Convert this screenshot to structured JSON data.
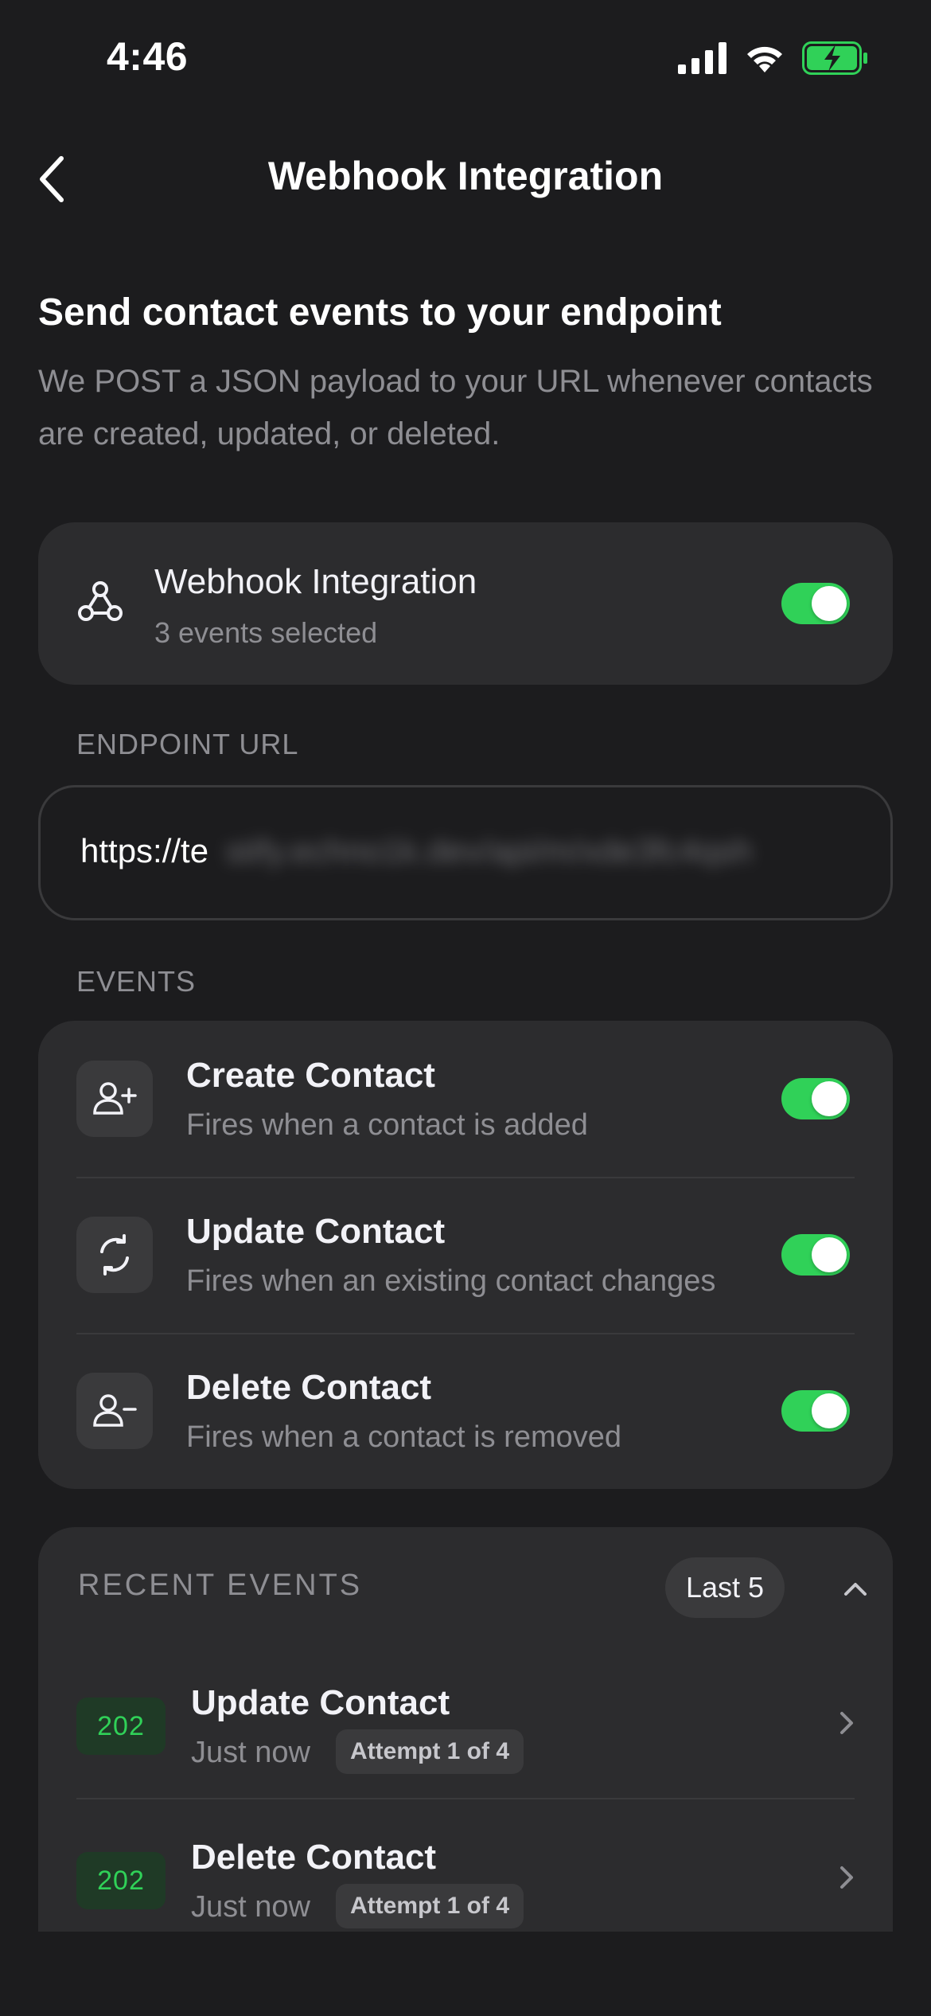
{
  "status_bar": {
    "time": "4:46"
  },
  "nav": {
    "title": "Webhook Integration"
  },
  "intro": {
    "heading": "Send contact events to your endpoint",
    "description": "We POST a JSON payload to your URL whenever contacts are created, updated, or deleted."
  },
  "integration": {
    "title": "Webhook Integration",
    "subtitle": "3 events selected",
    "enabled": true
  },
  "endpoint": {
    "label": "ENDPOINT URL",
    "url_visible": "https://te",
    "url_obscured": "stify.echno1k.dev/api/m/xde3fc4qsh"
  },
  "events": {
    "label": "EVENTS",
    "items": [
      {
        "title": "Create Contact",
        "description": "Fires when a contact is added",
        "enabled": true,
        "icon": "user-plus-icon"
      },
      {
        "title": "Update Contact",
        "description": "Fires when an existing contact changes",
        "enabled": true,
        "icon": "refresh-icon"
      },
      {
        "title": "Delete Contact",
        "description": "Fires when a contact is removed",
        "enabled": true,
        "icon": "user-minus-icon"
      }
    ]
  },
  "recent": {
    "label": "RECENT EVENTS",
    "filter_label": "Last 5",
    "items": [
      {
        "status": "202",
        "title": "Update Contact",
        "time": "Just now",
        "attempt": "Attempt 1 of 4"
      },
      {
        "status": "202",
        "title": "Delete Contact",
        "time": "Just now",
        "attempt": "Attempt 1 of 4"
      }
    ]
  },
  "colors": {
    "background": "#1c1c1e",
    "card": "#2c2c2e",
    "accent_green": "#30d158",
    "secondary_text": "#8e8e93"
  }
}
